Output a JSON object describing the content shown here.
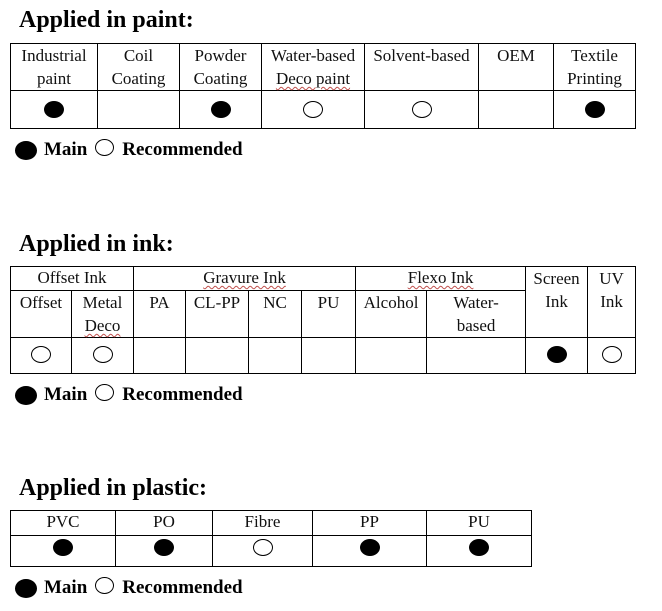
{
  "legend": {
    "main_label": "Main",
    "recommended_label": "Recommended"
  },
  "paint": {
    "title": "Applied in paint:",
    "columns": [
      {
        "line1": "Industrial",
        "line2": "paint",
        "rating": "main"
      },
      {
        "line1": "Coil",
        "line2": "Coating",
        "rating": "none"
      },
      {
        "line1": "Powder",
        "line2": "Coating",
        "rating": "main"
      },
      {
        "line1": "Water-based",
        "line2": "Deco paint",
        "rating": "recommended"
      },
      {
        "line1": "Solvent-based",
        "line2": "",
        "rating": "recommended"
      },
      {
        "line1": "OEM",
        "line2": "",
        "rating": "none"
      },
      {
        "line1": "Textile",
        "line2": "Printing",
        "rating": "main"
      }
    ]
  },
  "ink": {
    "title": "Applied in ink:",
    "groups": [
      {
        "label": "Offset Ink"
      },
      {
        "label": "Gravure Ink"
      },
      {
        "label": "Flexo Ink"
      }
    ],
    "columns": [
      {
        "line1": "Offset",
        "line2": "",
        "rating": "recommended"
      },
      {
        "line1": "Metal",
        "line2": "Deco",
        "rating": "recommended"
      },
      {
        "line1": "PA",
        "line2": "",
        "rating": "none"
      },
      {
        "line1": "CL-PP",
        "line2": "",
        "rating": "none"
      },
      {
        "line1": "NC",
        "line2": "",
        "rating": "none"
      },
      {
        "line1": "PU",
        "line2": "",
        "rating": "none"
      },
      {
        "line1": "Alcohol",
        "line2": "",
        "rating": "none"
      },
      {
        "line1": "Water-",
        "line2": "based",
        "rating": "none"
      },
      {
        "line1": "Screen",
        "line2": "Ink",
        "rating": "main"
      },
      {
        "line1": "UV",
        "line2": "Ink",
        "rating": "recommended"
      }
    ]
  },
  "plastic": {
    "title": "Applied in plastic:",
    "columns": [
      {
        "line1": "PVC",
        "rating": "main"
      },
      {
        "line1": "PO",
        "rating": "main"
      },
      {
        "line1": "Fibre",
        "rating": "recommended"
      },
      {
        "line1": "PP",
        "rating": "main"
      },
      {
        "line1": "PU",
        "rating": "main"
      }
    ]
  }
}
